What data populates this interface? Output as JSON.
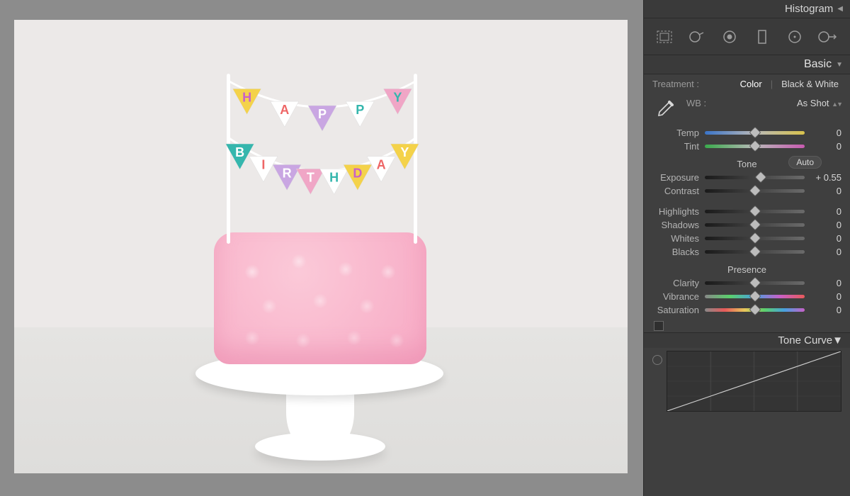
{
  "panels": {
    "histogram": {
      "title": "Histogram"
    },
    "basic": {
      "title": "Basic",
      "treatment_label": "Treatment :",
      "treatment_color": "Color",
      "treatment_bw": "Black & White",
      "wb_label": "WB :",
      "wb_value": "As Shot",
      "tone_label": "Tone",
      "auto_label": "Auto",
      "presence_label": "Presence"
    },
    "tonecurve": {
      "title": "Tone Curve"
    }
  },
  "sliders": {
    "temp": {
      "label": "Temp",
      "value": "0",
      "pos": 50
    },
    "tint": {
      "label": "Tint",
      "value": "0",
      "pos": 50
    },
    "exposure": {
      "label": "Exposure",
      "value": "+ 0.55",
      "pos": 56
    },
    "contrast": {
      "label": "Contrast",
      "value": "0",
      "pos": 50
    },
    "highlights": {
      "label": "Highlights",
      "value": "0",
      "pos": 50
    },
    "shadows": {
      "label": "Shadows",
      "value": "0",
      "pos": 50
    },
    "whites": {
      "label": "Whites",
      "value": "0",
      "pos": 50
    },
    "blacks": {
      "label": "Blacks",
      "value": "0",
      "pos": 50
    },
    "clarity": {
      "label": "Clarity",
      "value": "0",
      "pos": 50
    },
    "vibrance": {
      "label": "Vibrance",
      "value": "0",
      "pos": 50
    },
    "saturation": {
      "label": "Saturation",
      "value": "0",
      "pos": 50
    }
  },
  "image": {
    "banner_top": [
      "H",
      "A",
      "P",
      "P",
      "Y"
    ],
    "banner_bottom": [
      "B",
      "I",
      "R",
      "T",
      "H",
      "D",
      "A",
      "Y"
    ]
  }
}
